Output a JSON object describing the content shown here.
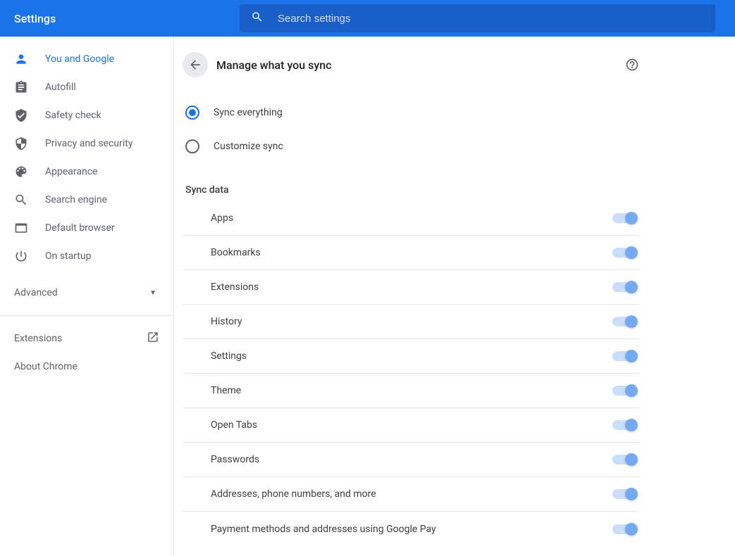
{
  "header": {
    "title": "Settings",
    "search_placeholder": "Search settings"
  },
  "sidebar": {
    "items": [
      {
        "label": "You and Google",
        "active": true
      },
      {
        "label": "Autofill"
      },
      {
        "label": "Safety check"
      },
      {
        "label": "Privacy and security"
      },
      {
        "label": "Appearance"
      },
      {
        "label": "Search engine"
      },
      {
        "label": "Default browser"
      },
      {
        "label": "On startup"
      }
    ],
    "advanced_label": "Advanced",
    "extensions_label": "Extensions",
    "about_label": "About Chrome"
  },
  "main": {
    "page_title": "Manage what you sync",
    "radio": {
      "sync_everything": "Sync everything",
      "customize_sync": "Customize sync",
      "selected": "sync_everything"
    },
    "section_title": "Sync data",
    "sync_items": [
      {
        "label": "Apps",
        "on": true
      },
      {
        "label": "Bookmarks",
        "on": true
      },
      {
        "label": "Extensions",
        "on": true
      },
      {
        "label": "History",
        "on": true
      },
      {
        "label": "Settings",
        "on": true
      },
      {
        "label": "Theme",
        "on": true
      },
      {
        "label": "Open Tabs",
        "on": true
      },
      {
        "label": "Passwords",
        "on": true
      },
      {
        "label": "Addresses, phone numbers, and more",
        "on": true
      },
      {
        "label": "Payment methods and addresses using Google Pay",
        "on": true
      }
    ]
  }
}
